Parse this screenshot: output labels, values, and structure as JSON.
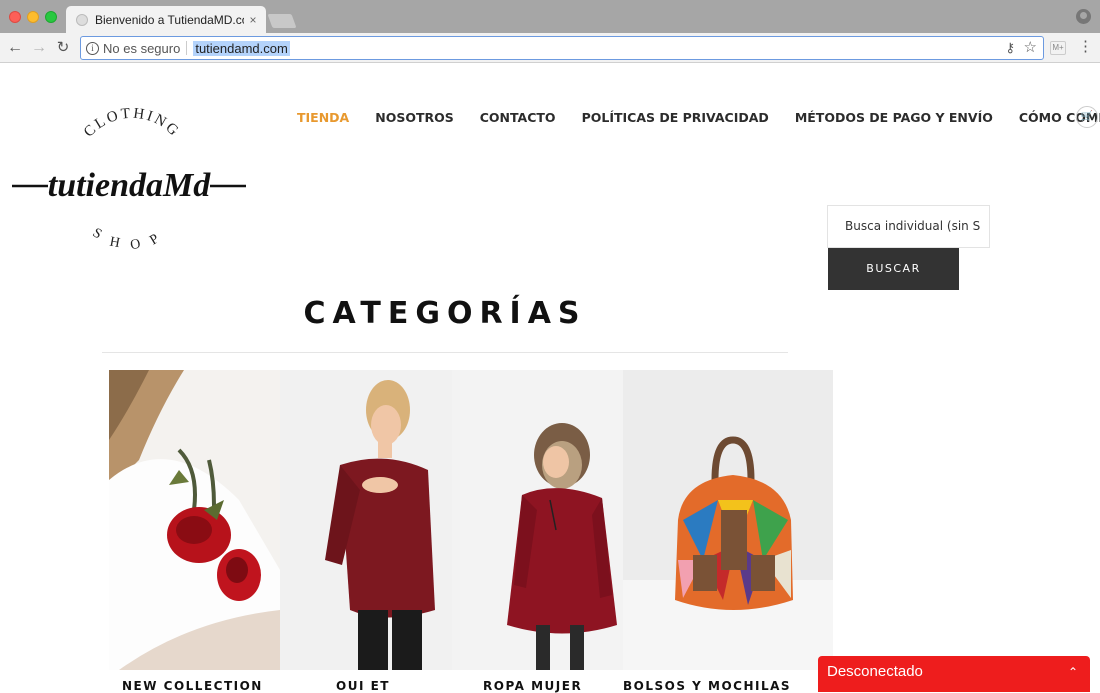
{
  "browser": {
    "tab_title": "Bienvenido a TutiendaMD.com",
    "tab_close": "×",
    "security_label": "No es seguro",
    "url": "tutiendamd.com",
    "ext_label": "M+"
  },
  "logo": {
    "top_text": "CLOTHING",
    "main_text": "tutiendaMd",
    "bottom_text": "SHOP"
  },
  "nav": {
    "items": [
      "TIENDA",
      "NOSOTROS",
      "CONTACTO",
      "POLÍTICAS DE PRIVACIDAD",
      "MÉTODOS DE PAGO Y ENVÍO",
      "CÓMO COMPRAR?"
    ],
    "active_index": 0
  },
  "search": {
    "value": "Busca individual  (sin S",
    "button_label": "BUSCAR"
  },
  "main": {
    "heading": "CATEGORÍAS",
    "categories": [
      {
        "label": "NEW COLLECTION"
      },
      {
        "label": "OUI ET"
      },
      {
        "label": "ROPA MUJER"
      },
      {
        "label": "BOLSOS Y MOCHILAS"
      }
    ]
  },
  "chat": {
    "status": "Desconectado"
  },
  "colors": {
    "accent": "#e8992f",
    "button": "#333333",
    "chat": "#ee1d1d"
  }
}
